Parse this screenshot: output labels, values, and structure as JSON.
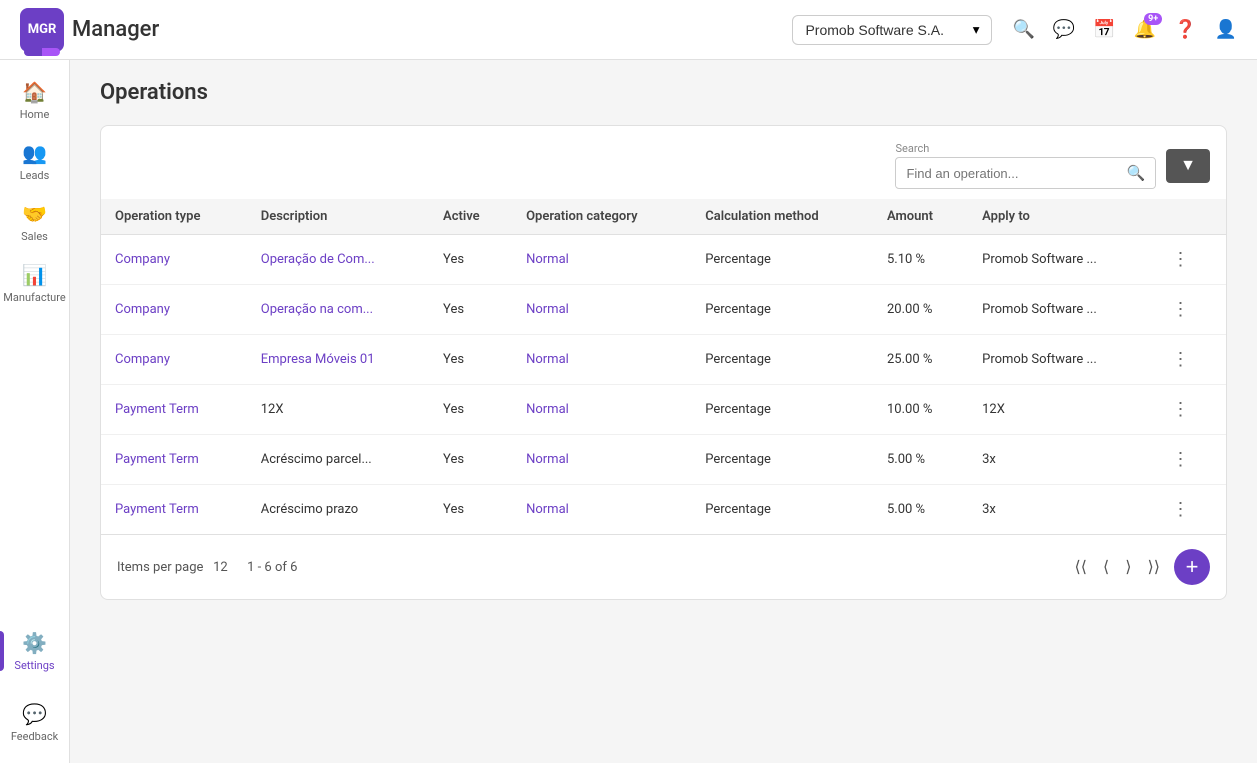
{
  "app": {
    "logo_text": "MGR",
    "title": "Manager"
  },
  "header": {
    "company": "Promob Software S.A.",
    "notification_badge": "9+",
    "search_icon": "🔍",
    "message_icon": "💬",
    "calendar_icon": "📅",
    "bell_icon": "🔔",
    "help_icon": "?",
    "user_icon": "👤"
  },
  "sidebar": {
    "items": [
      {
        "id": "home",
        "label": "Home",
        "icon": "🏠"
      },
      {
        "id": "leads",
        "label": "Leads",
        "icon": "👥"
      },
      {
        "id": "sales",
        "label": "Sales",
        "icon": "🤝"
      },
      {
        "id": "manufacture",
        "label": "Manufacture",
        "icon": "📊"
      },
      {
        "id": "settings",
        "label": "Settings",
        "icon": "⚙️",
        "active": true
      },
      {
        "id": "feedback",
        "label": "Feedback",
        "icon": "💬"
      }
    ]
  },
  "page": {
    "title": "Operations"
  },
  "toolbar": {
    "search_label": "Search",
    "search_placeholder": "Find an operation...",
    "filter_icon": "▼"
  },
  "table": {
    "columns": [
      "Operation type",
      "Description",
      "Active",
      "Operation category",
      "Calculation method",
      "Amount",
      "Apply to"
    ],
    "rows": [
      {
        "operation_type": "Company",
        "description": "Operação de Com...",
        "active": "Yes",
        "category": "Normal",
        "calc_method": "Percentage",
        "amount": "5.10 %",
        "apply_to": "Promob Software ..."
      },
      {
        "operation_type": "Company",
        "description": "Operação na com...",
        "active": "Yes",
        "category": "Normal",
        "calc_method": "Percentage",
        "amount": "20.00 %",
        "apply_to": "Promob Software ..."
      },
      {
        "operation_type": "Company",
        "description": "Empresa Móveis 01",
        "active": "Yes",
        "category": "Normal",
        "calc_method": "Percentage",
        "amount": "25.00 %",
        "apply_to": "Promob Software ..."
      },
      {
        "operation_type": "Payment Term",
        "description": "12X",
        "active": "Yes",
        "category": "Normal",
        "calc_method": "Percentage",
        "amount": "10.00 %",
        "apply_to": "12X"
      },
      {
        "operation_type": "Payment Term",
        "description": "Acréscimo parcel...",
        "active": "Yes",
        "category": "Normal",
        "calc_method": "Percentage",
        "amount": "5.00 %",
        "apply_to": "3x"
      },
      {
        "operation_type": "Payment Term",
        "description": "Acréscimo prazo",
        "active": "Yes",
        "category": "Normal",
        "calc_method": "Percentage",
        "amount": "5.00 %",
        "apply_to": "3x"
      }
    ]
  },
  "pagination": {
    "items_per_page_label": "Items per page",
    "items_per_page": "12",
    "range": "1 - 6 of 6"
  },
  "fab": {
    "label": "+"
  }
}
